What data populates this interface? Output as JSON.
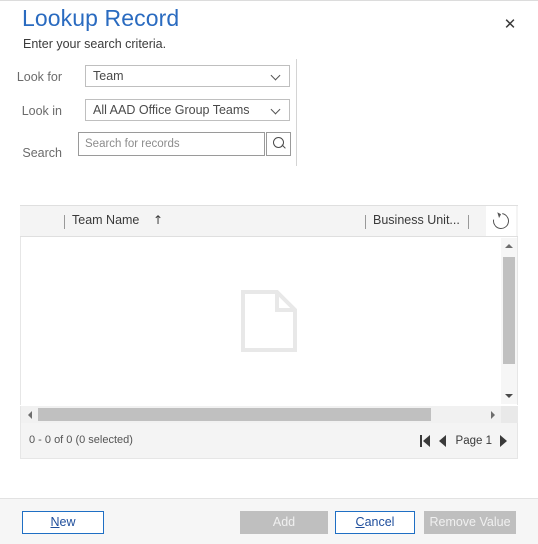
{
  "dialog": {
    "title": "Lookup Record",
    "subtitle": "Enter your search criteria.",
    "close_label": "✕"
  },
  "form": {
    "look_for": {
      "label": "Look for",
      "value": "Team"
    },
    "look_in": {
      "label": "Look in",
      "value": "All AAD Office Group Teams"
    },
    "search": {
      "label": "Search",
      "value": "",
      "placeholder": "Search for records"
    }
  },
  "grid": {
    "columns": [
      {
        "label": "Team Name",
        "sort": "↑"
      },
      {
        "label": "Business Unit...",
        "sort": ""
      }
    ],
    "rows": [],
    "empty_icon": "document-icon",
    "refresh_icon": "refresh-icon",
    "status": "0 - 0 of 0 (0 selected)",
    "pager": {
      "first_label": "first-page",
      "prev_label": "previous-page",
      "page_label": "Page 1",
      "next_label": "next-page"
    }
  },
  "footer": {
    "new": {
      "prefix": "",
      "accel": "N",
      "rest": "ew"
    },
    "add": {
      "label": "Add"
    },
    "cancel": {
      "prefix": "",
      "accel": "C",
      "rest": "ancel"
    },
    "remove": {
      "label": "Remove Value"
    }
  },
  "colors": {
    "title_blue": "#2a6bc0",
    "accent_border": "#1f6fc4",
    "disabled_bg": "#bfbfbf",
    "header_bg": "#f4f4f4",
    "footer_bg": "#f6f6f6",
    "empty_icon": "#e8e8e8"
  }
}
